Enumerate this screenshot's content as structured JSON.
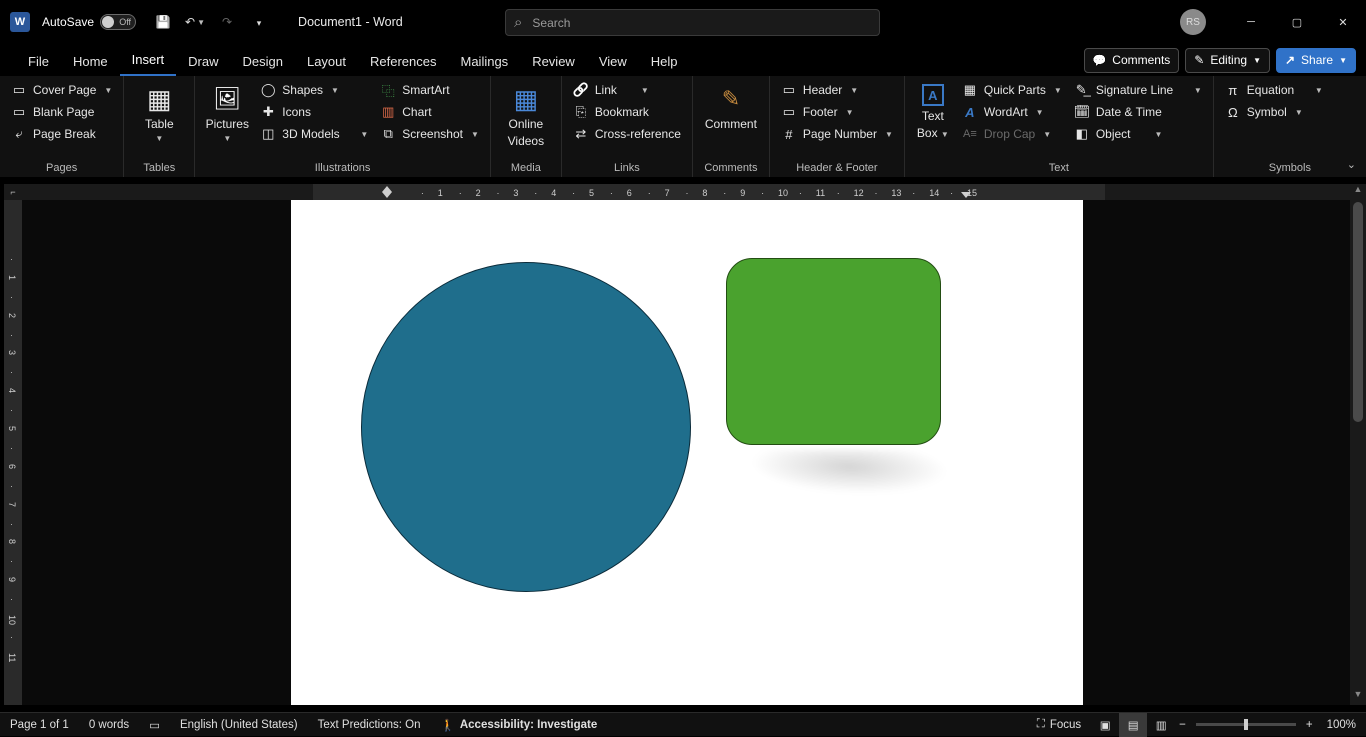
{
  "title": {
    "autosave": "AutoSave",
    "autosave_state": "Off",
    "doc": "Document1  -  Word",
    "search_placeholder": "Search",
    "avatar": "RS"
  },
  "tabs": [
    "File",
    "Home",
    "Insert",
    "Draw",
    "Design",
    "Layout",
    "References",
    "Mailings",
    "Review",
    "View",
    "Help"
  ],
  "active_tab": 2,
  "top_right": {
    "comments": "Comments",
    "editing": "Editing",
    "share": "Share"
  },
  "ribbon": {
    "pages": {
      "label": "Pages",
      "cover": "Cover Page",
      "blank": "Blank Page",
      "break": "Page Break"
    },
    "tables": {
      "label": "Tables",
      "table": "Table"
    },
    "illus": {
      "label": "Illustrations",
      "pictures": "Pictures",
      "shapes": "Shapes",
      "icons": "Icons",
      "models": "3D Models",
      "smartart": "SmartArt",
      "chart": "Chart",
      "screenshot": "Screenshot"
    },
    "media": {
      "label": "Media",
      "videos_l1": "Online",
      "videos_l2": "Videos"
    },
    "links": {
      "label": "Links",
      "link": "Link",
      "bookmark": "Bookmark",
      "crossref": "Cross-reference"
    },
    "comments": {
      "label": "Comments",
      "comment": "Comment"
    },
    "hf": {
      "label": "Header & Footer",
      "header": "Header",
      "footer": "Footer",
      "pagenum": "Page Number"
    },
    "text": {
      "label": "Text",
      "textbox_l1": "Text",
      "textbox_l2": "Box",
      "quickparts": "Quick Parts",
      "wordart": "WordArt",
      "dropcap": "Drop Cap",
      "sigline": "Signature Line",
      "datetime": "Date & Time",
      "object": "Object"
    },
    "symbols": {
      "label": "Symbols",
      "equation": "Equation",
      "symbol": "Symbol"
    }
  },
  "status": {
    "page": "Page 1 of 1",
    "words": "0 words",
    "lang": "English (United States)",
    "pred": "Text Predictions: On",
    "acc": "Accessibility: Investigate",
    "focus": "Focus",
    "zoom": "100%"
  },
  "ruler_h": [
    1,
    2,
    3,
    4,
    5,
    6,
    7,
    8,
    9,
    10,
    11,
    12,
    13,
    14,
    15
  ],
  "ruler_v": [
    1,
    2,
    3,
    4,
    5,
    6,
    7,
    8,
    9,
    10,
    11
  ]
}
